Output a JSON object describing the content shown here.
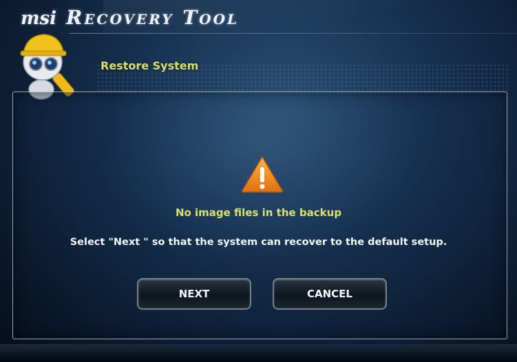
{
  "app": {
    "brand": "msi",
    "title": "Recovery Tool"
  },
  "section": {
    "title": "Restore System"
  },
  "dialog": {
    "heading": "No image files in the backup",
    "message": "Select \"Next \" so that the system can recover to the default setup.",
    "warning_icon": "warning-triangle-icon"
  },
  "buttons": {
    "next_label": "NEXT",
    "cancel_label": "CANCEL"
  },
  "colors": {
    "accent_yellow": "#d9e26a",
    "warning_orange": "#f08a1c",
    "background": "#0b1a2e"
  }
}
